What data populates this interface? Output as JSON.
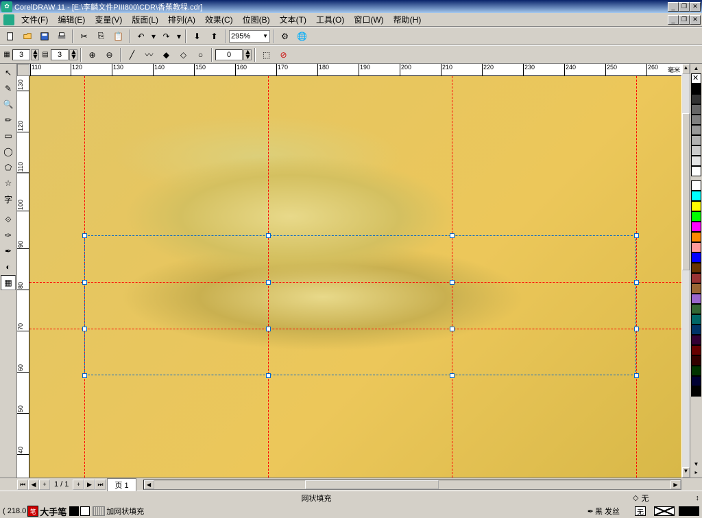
{
  "title": {
    "app": "CorelDRAW 11",
    "sep": " - ",
    "doc": "[E:\\李麟文件PIII800\\CDR\\香蕉教程.cdr]"
  },
  "menu": [
    "文件(F)",
    "编辑(E)",
    "变量(V)",
    "版面(L)",
    "排列(A)",
    "效果(C)",
    "位图(B)",
    "文本(T)",
    "工具(O)",
    "窗口(W)",
    "帮助(H)"
  ],
  "zoom": "295%",
  "grid": {
    "cols": "3",
    "rows": "3"
  },
  "node_field": "0",
  "ruler_unit": "毫米",
  "ruler_h": [
    110,
    120,
    130,
    140,
    150,
    160,
    170,
    180,
    190,
    200,
    210,
    220,
    230,
    240,
    250,
    260
  ],
  "ruler_v": [
    130,
    120,
    110,
    100,
    90,
    80,
    70,
    60,
    50,
    40
  ],
  "page": {
    "current": "1",
    "total": "1",
    "tab": "页 1",
    "navlabel": "1 / 1"
  },
  "status": {
    "coords": "( 218.0",
    "tool_label": "大手笔",
    "mesh_label": "加网状填充",
    "center": "网状填充",
    "fill_none": "无",
    "outline": "黑 发丝",
    "nofill_box": "无"
  },
  "colors": [
    "#000000",
    "#333333",
    "#666666",
    "#999999",
    "#b2b2b2",
    "#cccccc",
    "#e5e5e5",
    "#ffffff",
    "#00ffff",
    "#ffff00",
    "#00ff00",
    "#ff00ff",
    "#ff8000",
    "#ff9999",
    "#0000ff",
    "#663300",
    "#993333",
    "#996633",
    "#9966cc",
    "#336633"
  ]
}
